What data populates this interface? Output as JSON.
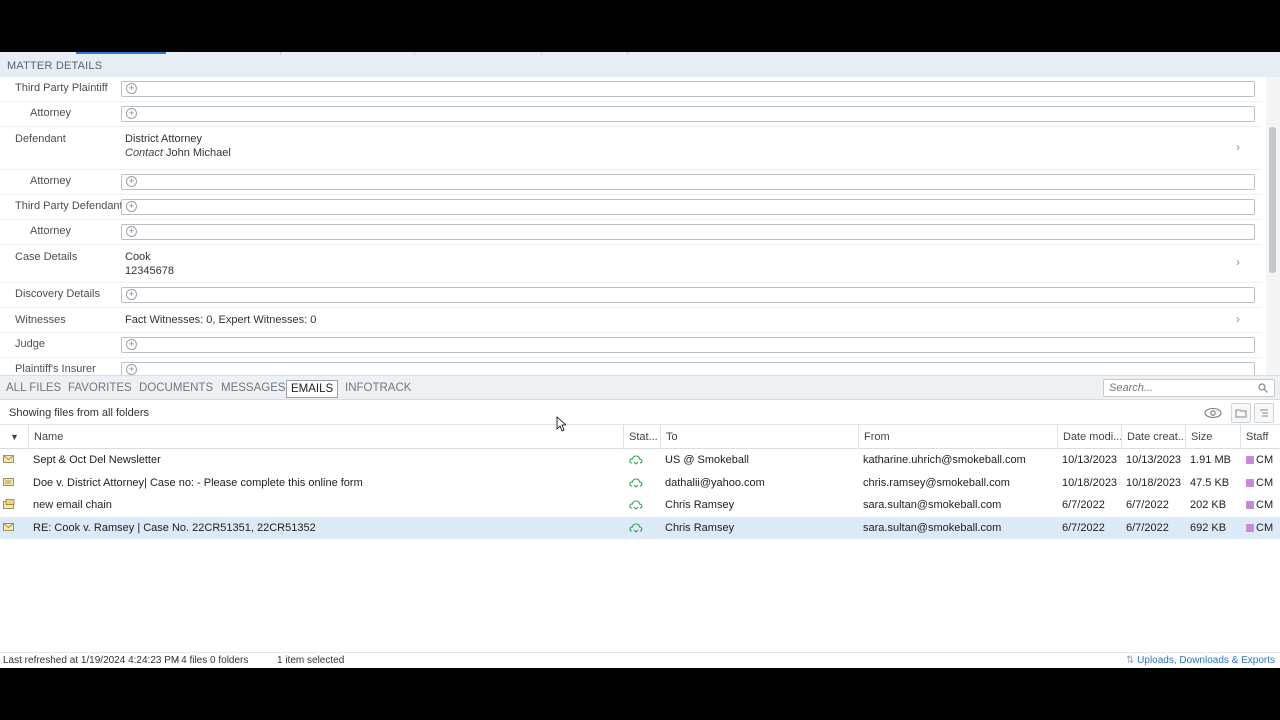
{
  "section_title": "MATTER DETAILS",
  "details": [
    {
      "label": "Third Party Plaintiff",
      "indent": false,
      "kind": "empty"
    },
    {
      "label": "Attorney",
      "indent": true,
      "kind": "empty"
    },
    {
      "label": "Defendant",
      "indent": false,
      "kind": "value",
      "line1": "District Attorney",
      "line2_prefix": "Contact",
      "line2": "John Michael"
    },
    {
      "label": "Attorney",
      "indent": true,
      "kind": "empty"
    },
    {
      "label": "Third Party Defendant",
      "indent": false,
      "kind": "empty"
    },
    {
      "label": "Attorney",
      "indent": true,
      "kind": "empty"
    },
    {
      "label": "Case Details",
      "indent": false,
      "kind": "value",
      "line1": "Cook",
      "line2": "12345678"
    },
    {
      "label": "Discovery Details",
      "indent": false,
      "kind": "empty"
    },
    {
      "label": "Witnesses",
      "indent": false,
      "kind": "value",
      "line1": "Fact Witnesses: 0, Expert Witnesses: 0"
    },
    {
      "label": "Judge",
      "indent": false,
      "kind": "empty"
    },
    {
      "label": "Plaintiff's Insurer",
      "indent": false,
      "kind": "empty"
    }
  ],
  "tabs": [
    "ALL FILES",
    "FAVORITES",
    "DOCUMENTS",
    "MESSAGES",
    "EMAILS",
    "INFOTRACK"
  ],
  "active_tab": "EMAILS",
  "search_placeholder": "Search...",
  "filter_text": "Showing files from all folders",
  "columns": [
    "Name",
    "Stat...",
    "To",
    "From",
    "Date modi...",
    "Date creat...",
    "Size",
    "Staff"
  ],
  "rows": [
    {
      "icon": "email-attachment-icon",
      "name": "Sept & Oct Del Newsletter",
      "to": "US @ Smokeball",
      "from": "katharine.uhrich@smokeball.com",
      "modified": "10/13/2023",
      "created": "10/13/2023",
      "size": "1.91 MB",
      "staff": "CM",
      "selected": false
    },
    {
      "icon": "email-form-icon",
      "name": "Doe v. District Attorney| Case no: - Please complete this online form",
      "to": "dathalii@yahoo.com",
      "from": "chris.ramsey@smokeball.com",
      "modified": "10/18/2023",
      "created": "10/18/2023",
      "size": "47.5 KB",
      "staff": "CM",
      "selected": false
    },
    {
      "icon": "email-chain-icon",
      "name": "new email chain",
      "to": "Chris Ramsey",
      "from": "sara.sultan@smokeball.com",
      "modified": "6/7/2022",
      "created": "6/7/2022",
      "size": "202 KB",
      "staff": "CM",
      "selected": false
    },
    {
      "icon": "email-attachment-icon",
      "name": "RE: Cook v. Ramsey | Case No. 22CR51351, 22CR51352",
      "to": "Chris Ramsey",
      "from": "sara.sultan@smokeball.com",
      "modified": "6/7/2022",
      "created": "6/7/2022",
      "size": "692 KB",
      "staff": "CM",
      "selected": true
    }
  ],
  "status": {
    "refreshed": "Last refreshed at 1/19/2024 4:24:23 PM",
    "files": "- 4 files 0 folders",
    "selected": "1 item selected",
    "link": "Uploads, Downloads & Exports"
  },
  "colors": {
    "accent": "#2b7bd1",
    "selected_row": "#dce9f7",
    "sync_icon": "#2ea44f",
    "staff_chip": "#c78ad6"
  }
}
